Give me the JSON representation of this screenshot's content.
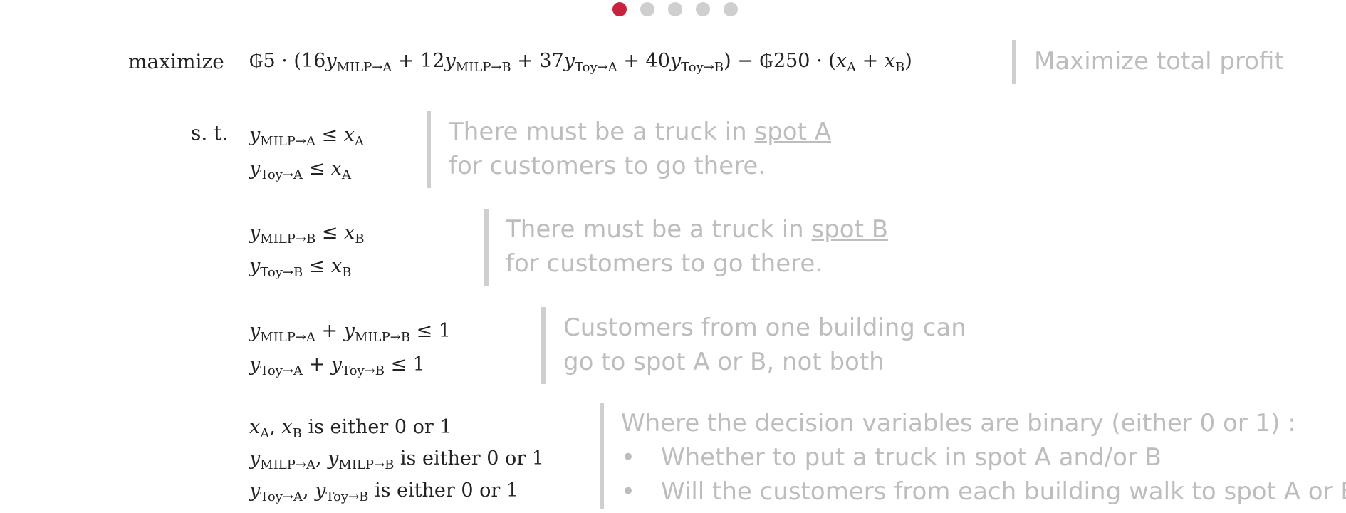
{
  "slide_dots": {
    "count": 5,
    "active": 0
  },
  "objective": {
    "keyword": "maximize",
    "currency": "₲",
    "price": "5",
    "coef": [
      "16",
      "12",
      "37",
      "40"
    ],
    "truck_cost": "250",
    "caption": "Maximize total profit"
  },
  "subject_to": "s. t.",
  "vars": {
    "milp_a": "MILP→A",
    "milp_b": "MILP→B",
    "toy_a": "Toy→A",
    "toy_b": "Toy→B",
    "spot_a": "A",
    "spot_b": "B"
  },
  "c1": {
    "caption_1a": "There must be a truck in ",
    "caption_1b": "spot A",
    "caption_2": "for customers to go there."
  },
  "c2": {
    "caption_1a": "There must be a truck in ",
    "caption_1b": "spot B",
    "caption_2": "for customers to go there."
  },
  "c3": {
    "rhs": "1",
    "caption_1": "Customers from one building can",
    "caption_2": "go to spot A or B, not both"
  },
  "c4": {
    "either_text": "is either 0 or 1",
    "caption_head": "Where the decision variables are binary (either 0 or 1) :",
    "bullet_1": "Whether to put a truck in spot A and/or B",
    "bullet_2": "Will the customers from each building walk to spot A or B",
    "bullet_glyph": "•"
  }
}
